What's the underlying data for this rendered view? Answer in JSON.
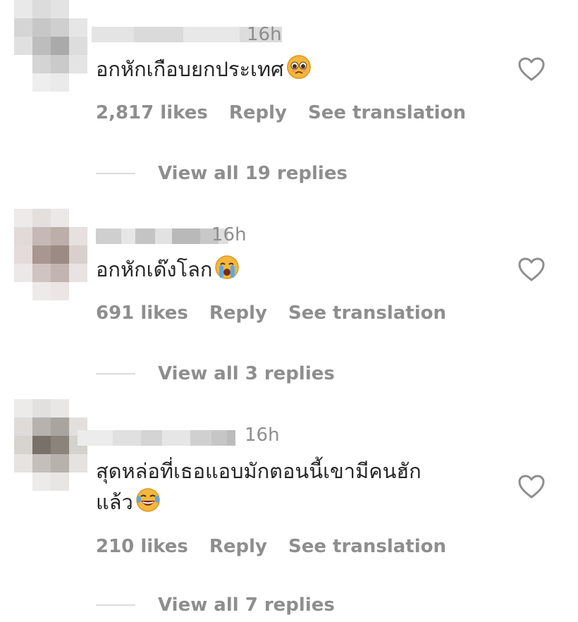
{
  "comments": [
    {
      "time": "16h",
      "text": "อกหักเกือบยกประเทศ",
      "emoji": "pleading-face-emoji",
      "likes": "2,817 likes",
      "reply": "Reply",
      "translate": "See translation",
      "view_replies": "View all 19 replies"
    },
    {
      "time": "16h",
      "text": "อกหักเด๊งโลก",
      "emoji": "crying-face-emoji",
      "likes": "691 likes",
      "reply": "Reply",
      "translate": "See translation",
      "view_replies": "View all 3 replies"
    },
    {
      "time": "16h",
      "text_line1": "สุดหล่อที่เธอแอบมักตอนนี้เขามีคนฮัก",
      "text_line2": "แล้ว",
      "emoji": "laughing-tears-emoji",
      "likes": "210 likes",
      "reply": "Reply",
      "translate": "See translation",
      "view_replies": "View all 7 replies"
    }
  ],
  "colors": {
    "text": "#262626",
    "muted": "#8e8e8e",
    "divider": "#dbdbdb"
  }
}
